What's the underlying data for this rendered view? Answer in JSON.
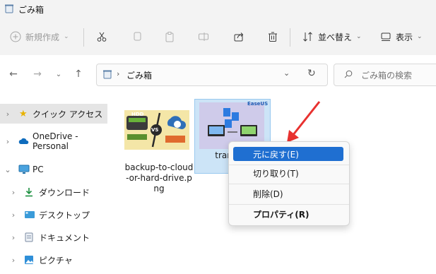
{
  "window": {
    "title": "ごみ箱"
  },
  "toolbar": {
    "new_label": "新規作成",
    "sort_label": "並べ替え",
    "view_label": "表示"
  },
  "address": {
    "path": "ごみ箱",
    "search_placeholder": "ごみ箱の検索"
  },
  "nav": {
    "quick_access": "クイック アクセス",
    "onedrive": "OneDrive - Personal",
    "pc": "PC",
    "downloads": "ダウンロード",
    "desktop": "デスクトップ",
    "documents": "ドキュメント",
    "pictures": "ピクチャ"
  },
  "files": [
    {
      "name": "backup-to-cloud-or-hard-drive.png",
      "name_lines": [
        "backup-to-cloud",
        "-or-hard-drive.p",
        "ng"
      ],
      "thumb_text": {
        "hdd": "HDD",
        "vs": "VS"
      }
    },
    {
      "name": "transfer…s.",
      "name_lines": [
        "transfer",
        "s."
      ],
      "thumb_text": {
        "brand": "EaseUS"
      }
    }
  ],
  "context_menu": {
    "items": [
      {
        "label": "元に戻す(E)",
        "highlighted": true
      },
      {
        "label": "切り取り(T)"
      },
      {
        "label": "削除(D)"
      },
      {
        "label": "プロパティ(R)",
        "bold": true
      }
    ]
  },
  "colors": {
    "accent": "#1f6fd1",
    "selection": "#cce4f7",
    "arrow": "#e8312f"
  }
}
